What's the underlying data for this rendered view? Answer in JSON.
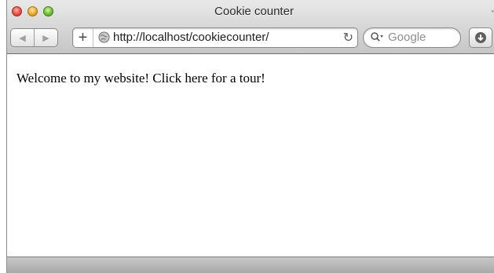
{
  "window": {
    "title": "Cookie counter"
  },
  "toolbar": {
    "back_glyph": "◀",
    "forward_glyph": "▶",
    "add_glyph": "+",
    "url": "http://localhost/cookiecounter/",
    "reload_glyph": "↻",
    "search_placeholder": "Google"
  },
  "page": {
    "text": "Welcome to my website! Click here for a tour!"
  },
  "icons": {
    "close": "close-icon",
    "minimize": "minimize-icon",
    "maximize": "maximize-icon",
    "fullscreen": "fullscreen-icon",
    "globe": "globe-icon",
    "search": "search-icon",
    "download": "download-icon"
  },
  "colors": {
    "close": "#ef5a4d",
    "minimize": "#f4b53a",
    "maximize": "#7ecb3f"
  }
}
